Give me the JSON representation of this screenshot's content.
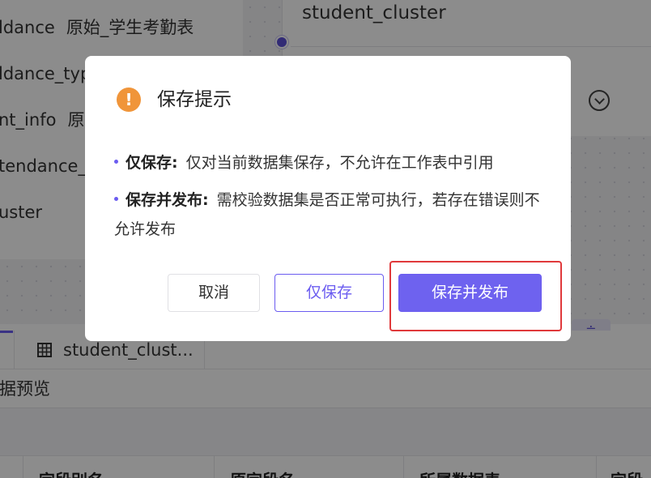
{
  "datasets": [
    {
      "name": "ldance",
      "desc": "原始_学生考勤表"
    },
    {
      "name": "ldance_type",
      "desc": ""
    },
    {
      "name": "nt_info",
      "desc": "原始"
    },
    {
      "name": "tendance_s",
      "desc": ""
    },
    {
      "name": "uster",
      "desc": ""
    }
  ],
  "canvas": {
    "node_title": "student_cluster"
  },
  "tabs": {
    "student_tab_label": "student_clust..."
  },
  "preview": {
    "label": "据预览"
  },
  "table": {
    "columns": [
      "字段别名",
      "原字段名",
      "所属数据表",
      "字段"
    ]
  },
  "modal": {
    "title": "保存提示",
    "icon": "exclamation-icon",
    "icon_glyph": "!",
    "items": [
      {
        "key": "仅保存:",
        "text": "仅对当前数据集保存，不允许在工作表中引用"
      },
      {
        "key": "保存并发布:",
        "text": "需校验数据集是否正常可执行，若存在错误则不允许发布"
      }
    ],
    "buttons": {
      "cancel": "取消",
      "save_only": "仅保存",
      "save_publish": "保存并发布"
    }
  },
  "colors": {
    "accent": "#6e62ef",
    "warning": "#f0953a",
    "highlight": "#e0393b"
  }
}
